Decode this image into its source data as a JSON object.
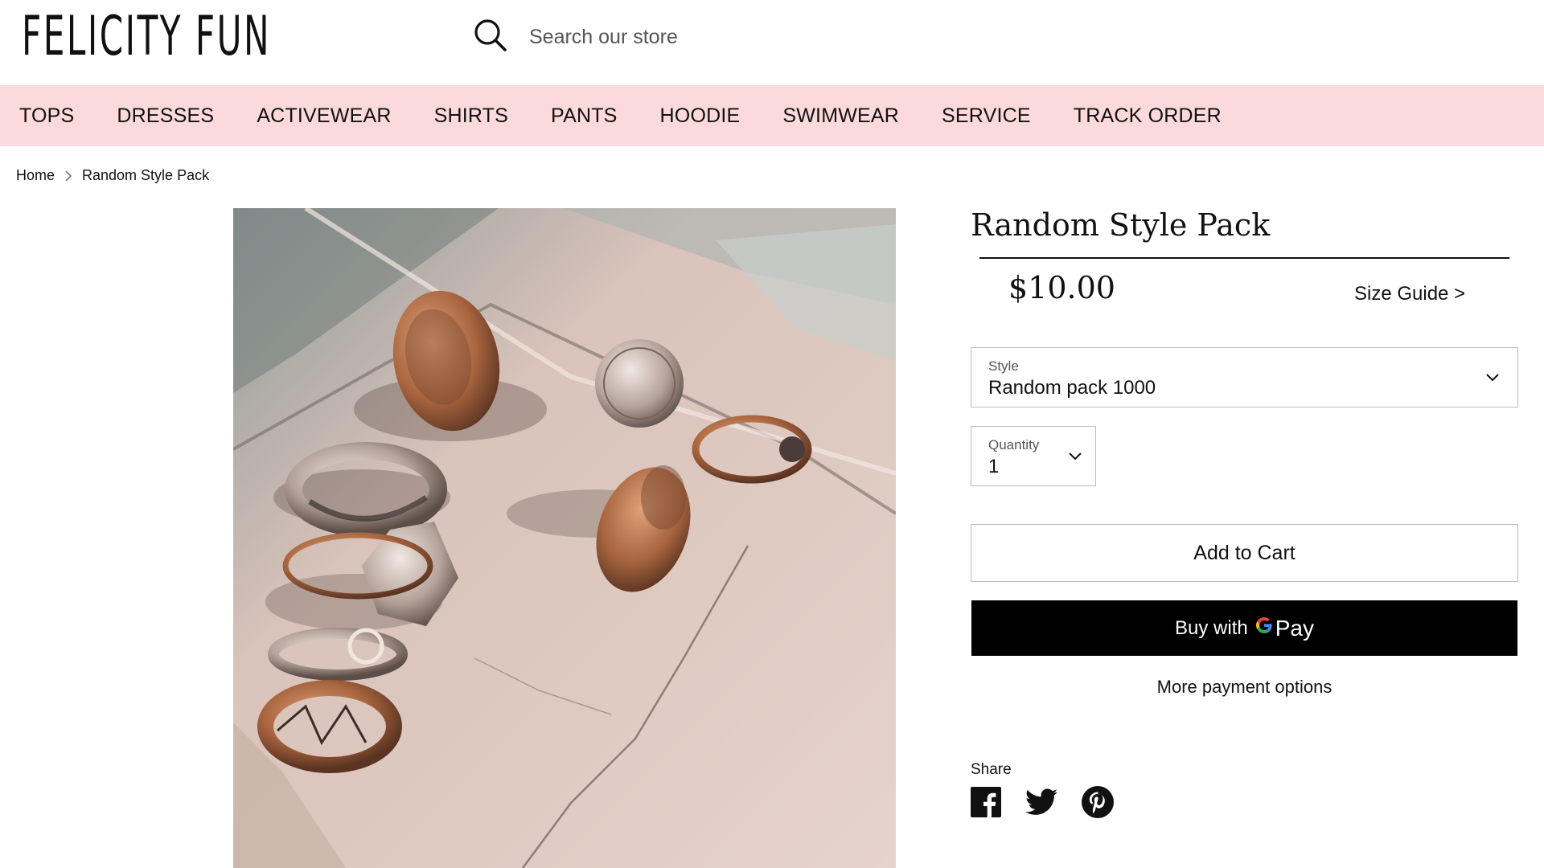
{
  "header": {
    "logo": "FELICITY FUN",
    "search_placeholder": "Search our store"
  },
  "nav": {
    "items": [
      "TOPS",
      "DRESSES",
      "ACTIVEWEAR",
      "SHIRTS",
      "PANTS",
      "HOODIE",
      "SWIMWEAR",
      "SERVICE",
      "TRACK ORDER"
    ]
  },
  "breadcrumb": {
    "home": "Home",
    "current": "Random Style Pack"
  },
  "product": {
    "title": "Random Style Pack",
    "price": "$10.00",
    "size_guide": "Size Guide >",
    "style_label": "Style",
    "style_value": "Random pack 1000",
    "quantity_label": "Quantity",
    "quantity_value": "1",
    "add_to_cart": "Add to Cart",
    "buy_with": "Buy with",
    "gpay_g": "G",
    "gpay_pay": "Pay",
    "more_payment": "More payment options",
    "share_label": "Share"
  },
  "colors": {
    "nav_bg": "#fcd9da",
    "gpay_bg": "#000000"
  },
  "icons": [
    "search-icon",
    "chevron-right-icon",
    "chevron-down-icon",
    "facebook-icon",
    "twitter-icon",
    "pinterest-icon",
    "google-g-icon"
  ]
}
